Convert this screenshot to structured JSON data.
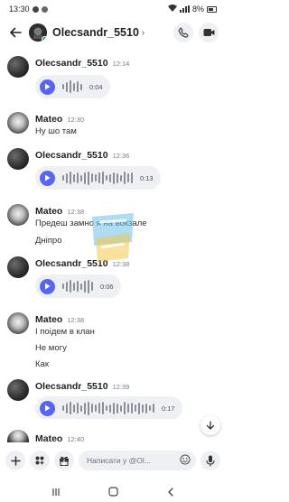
{
  "status": {
    "time": "13:30",
    "battery": "8%"
  },
  "header": {
    "channel_name": "Olecsandr_5510"
  },
  "messages": [
    {
      "author": "Olecsandr_5510",
      "time": "12:14",
      "voice_duration": "0:04"
    },
    {
      "author": "Mateo",
      "time": "12:30",
      "lines": [
        "Ну шо там"
      ]
    },
    {
      "author": "Olecsandr_5510",
      "time": "12:36",
      "voice_duration": "0:13"
    },
    {
      "author": "Mateo",
      "time": "12:38",
      "lines": [
        "Предеш замно я на вокзале",
        "Дніпро"
      ]
    },
    {
      "author": "Olecsandr_5510",
      "time": "12:38",
      "voice_duration": "0:06"
    },
    {
      "author": "Mateo",
      "time": "12:38",
      "lines": [
        "І поідем в клан",
        "Не могу",
        "Как"
      ]
    },
    {
      "author": "Olecsandr_5510",
      "time": "12:39",
      "voice_duration": "0:17"
    },
    {
      "author": "Mateo",
      "time": "12:40"
    }
  ],
  "composer": {
    "placeholder": "Написати у @Ol..."
  },
  "colors": {
    "accent": "#5865f2",
    "online": "#23a55a",
    "bubble": "#eef0f4"
  }
}
